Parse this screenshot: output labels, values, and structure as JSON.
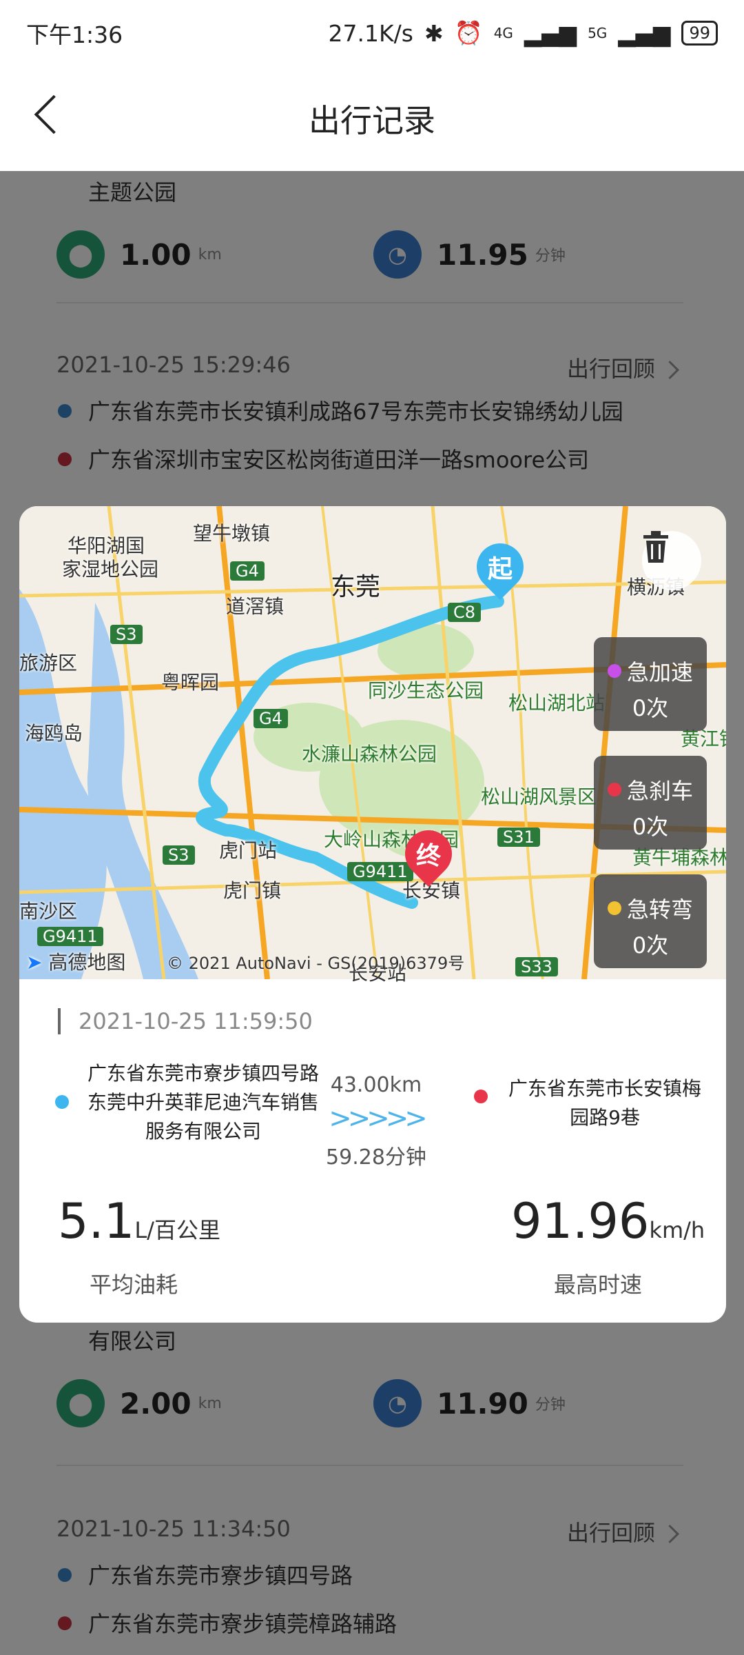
{
  "status": {
    "time": "下午1:36",
    "speed": "27.1K/s",
    "battery": "99",
    "network1": "4G",
    "network2": "5G"
  },
  "header": {
    "title": "出行记录"
  },
  "list": [
    {
      "addr_to": "主题公园",
      "distance": "1.00",
      "distance_unit": "km",
      "duration": "11.95",
      "duration_unit": "分钟"
    },
    {
      "date": "2021-10-25 15:29:46",
      "review": "出行回顾",
      "addr_from": "广东省东莞市长安镇利成路67号东莞市长安锦绣幼儿园",
      "addr_to": "广东省深圳市宝安区松岗街道田洋一路smoore公司"
    },
    {
      "addr_to": "有限公司",
      "distance": "2.00",
      "distance_unit": "km",
      "duration": "11.90",
      "duration_unit": "分钟"
    },
    {
      "date": "2021-10-25 11:34:50",
      "review": "出行回顾",
      "addr_from": "广东省东莞市寮步镇四号路",
      "addr_to": "广东省东莞市寮步镇莞樟路辅路"
    }
  ],
  "dialog": {
    "map_labels": {
      "dongguan": "东莞",
      "huayang": "华阳湖国",
      "wetland": "家湿地公园",
      "wangniu": "望牛墩镇",
      "daojiao": "道滘镇",
      "yuehui": "粤晖园",
      "lvyou": "旅游区",
      "haiou": "海鸥岛",
      "tongsha": "同沙生态公园",
      "songshanhu": "松山湖北站",
      "shuilian": "水濂山森林公园",
      "songshanscenic": "松山湖风景区",
      "humen": "虎门站",
      "humenzhen": "虎门镇",
      "dalingshan": "大岭山森林公园",
      "changanzhen": "长安镇",
      "nansha": "南沙区",
      "huangjiang": "黄江镇",
      "huangniupu": "黄牛埔森林",
      "changanzhan": "长安站",
      "heng": "横沥镇"
    },
    "road_badges": {
      "g4": "G4",
      "s3": "S3",
      "s3b": "S3",
      "g4b": "G4",
      "s31": "S31",
      "g9411": "G9411",
      "g9411b": "G9411",
      "s33": "S33",
      "c8": "C8"
    },
    "pins": {
      "start": "起",
      "end": "终"
    },
    "copyright": "© 2021 AutoNavi - GS(2019)6379号",
    "amap": "高德地图",
    "events": [
      {
        "label": "急加速",
        "count": "0次",
        "color": "#c850e8"
      },
      {
        "label": "急刹车",
        "count": "0次",
        "color": "#e8354a"
      },
      {
        "label": "急转弯",
        "count": "0次",
        "color": "#f2c230"
      }
    ],
    "date": "2021-10-25 11:59:50",
    "from_addr": "广东省东莞市寮步镇四号路东莞中升英菲尼迪汽车销售服务有限公司",
    "to_addr": "广东省东莞市长安镇梅园路9巷",
    "distance": "43.00km",
    "duration": "59.28分钟",
    "arrows": ">>>>>",
    "fuel": "5.1",
    "fuel_unit": "L/百公里",
    "fuel_caption": "平均油耗",
    "max_speed": "91.96",
    "speed_unit": "km/h",
    "speed_caption": "最高时速"
  },
  "colors": {
    "start_dot": "#3db6ef",
    "end_dot": "#e8354a",
    "list_dot_blue": "#3a86c8",
    "list_dot_red": "#c83040",
    "distance_icon": "#2aa876",
    "time_icon": "#3a7fcf",
    "route": "#4cc3ec"
  }
}
